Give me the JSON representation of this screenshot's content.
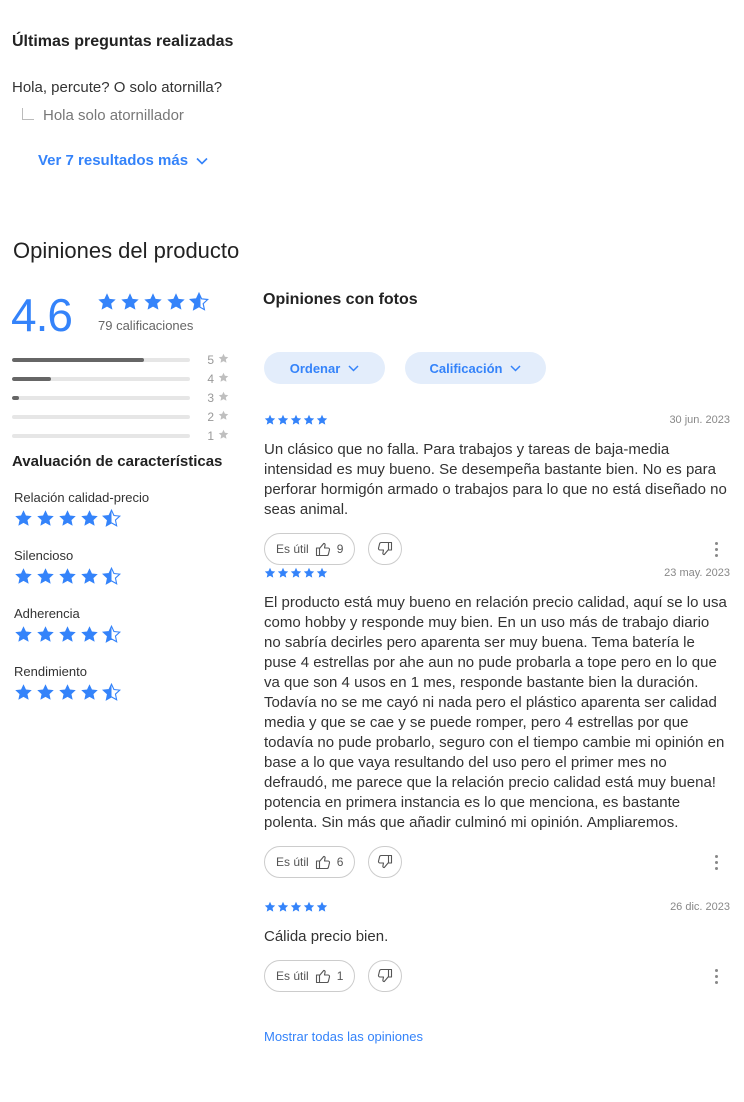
{
  "questions": {
    "title": "Últimas preguntas realizadas",
    "question": "Hola, percute? O solo atornilla?",
    "answer": "Hola solo atornillador",
    "more_label": "Ver 7 resultados más"
  },
  "reviews": {
    "title": "Opiniones del producto",
    "summary": {
      "average": "4.6",
      "average_value": 4.6,
      "count_label": "79 calificaciones",
      "distribution": [
        {
          "label": "5",
          "fraction": 0.74
        },
        {
          "label": "4",
          "fraction": 0.22
        },
        {
          "label": "3",
          "fraction": 0.04
        },
        {
          "label": "2",
          "fraction": 0.0
        },
        {
          "label": "1",
          "fraction": 0.0
        }
      ]
    },
    "characteristics": {
      "title": "Avaluación de características",
      "items": [
        {
          "name": "Relación calidad-precio",
          "rating": 4.5
        },
        {
          "name": "Silencioso",
          "rating": 4.5
        },
        {
          "name": "Adherencia",
          "rating": 4.5
        },
        {
          "name": "Rendimiento",
          "rating": 4.5
        }
      ]
    },
    "photos_title": "Opiniones con fotos",
    "filters": {
      "sort_label": "Ordenar",
      "rating_label": "Calificación"
    },
    "items": [
      {
        "rating": 5,
        "date": "30 jun. 2023",
        "text": "Un clásico que no falla. Para trabajos y tareas de baja-media intensidad es muy bueno. Se desempeña bastante bien. No es para perforar hormigón armado o trabajos para lo que no está diseñado no seas animal.",
        "useful_label": "Es útil",
        "useful_count": "9"
      },
      {
        "rating": 5,
        "date": "23 may. 2023",
        "text": "El producto está muy bueno en relación precio calidad, aquí se lo usa como hobby y responde muy bien. En un uso más de trabajo diario no sabría decirles pero aparenta ser muy buena. Tema batería le puse 4 estrellas por ahe aun no pude probarla a tope pero en lo que va que son 4 usos en 1 mes, responde bastante bien la duración. Todavía no se me cayó ni nada pero el plástico aparenta ser calidad media y que se cae y se puede romper, pero 4 estrellas por que todavía no pude probarlo, seguro con el tiempo cambie mi opinión en base a lo que vaya resultando del uso pero el primer mes no defraudó, me parece que la relación precio calidad está muy buena! potencia en primera instancia es lo que menciona, es bastante polenta. Sin más que añadir culminó mi opinión. Ampliaremos.",
        "useful_label": "Es útil",
        "useful_count": "6"
      },
      {
        "rating": 5,
        "date": "26 dic. 2023",
        "text": "Cálida precio bien.",
        "useful_label": "Es útil",
        "useful_count": "1"
      }
    ],
    "show_all_label": "Mostrar todas las opiniones"
  },
  "colors": {
    "accent": "#3483fa",
    "star_empty": "#bfbfbf"
  },
  "icons": {
    "star": "star-icon",
    "chevron": "chevron-down-icon",
    "thumb_up": "thumb-up-icon",
    "thumb_down": "thumb-down-icon",
    "more": "kebab-menu-icon"
  }
}
